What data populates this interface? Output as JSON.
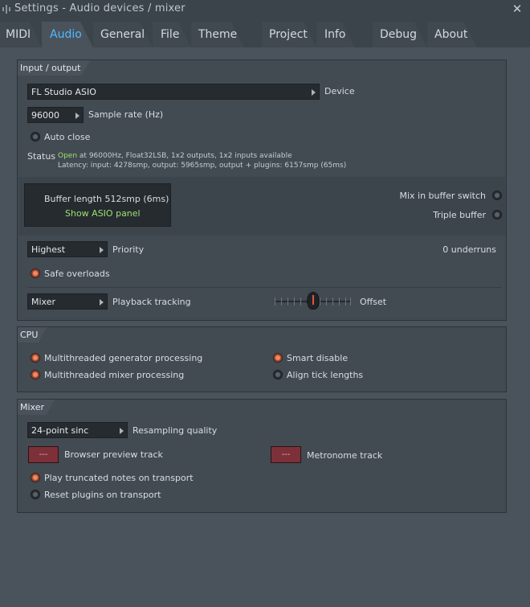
{
  "window": {
    "title": "Settings - Audio devices / mixer",
    "close_icon": "close-icon"
  },
  "tabs": [
    {
      "label": "MIDI"
    },
    {
      "label": "Audio"
    },
    {
      "label": "General"
    },
    {
      "label": "File"
    },
    {
      "label": "Theme"
    },
    {
      "label": "Project"
    },
    {
      "label": "Info"
    },
    {
      "label": "Debug"
    },
    {
      "label": "About"
    }
  ],
  "active_tab": "Audio",
  "io": {
    "header": "Input / output",
    "device_value": "FL Studio ASIO",
    "device_label": "Device",
    "sample_rate_value": "96000",
    "sample_rate_label": "Sample rate (Hz)",
    "auto_close_label": "Auto close",
    "status_label": "Status",
    "status_open": "Open",
    "status_line1_rest": " at 96000Hz, Float32LSB, 1x2 outputs, 1x2 inputs available",
    "status_line2": "Latency: input: 4278smp, output: 5965smp, output + plugins: 6157smp (65ms)",
    "buffer_length": "Buffer length 512smp (6ms)",
    "show_asio_panel": "Show ASIO panel",
    "mix_in_buffer_switch": "Mix in buffer switch",
    "triple_buffer": "Triple buffer",
    "priority_value": "Highest",
    "priority_label": "Priority",
    "underruns": "0 underruns",
    "safe_overloads": "Safe overloads",
    "playback_value": "Mixer",
    "playback_label": "Playback tracking",
    "offset_label": "Offset",
    "offset_level": 0.5
  },
  "cpu": {
    "header": "CPU",
    "multithreaded_generator": "Multithreaded generator processing",
    "multithreaded_mixer": "Multithreaded mixer processing",
    "smart_disable": "Smart disable",
    "align_tick_lengths": "Align tick lengths"
  },
  "mixer": {
    "header": "Mixer",
    "resampling_value": "24-point sinc",
    "resampling_label": "Resampling quality",
    "browser_preview_btn": "---",
    "browser_preview_label": "Browser preview track",
    "metronome_btn": "---",
    "metronome_label": "Metronome track",
    "play_truncated": "Play truncated notes on transport",
    "reset_plugins": "Reset plugins on transport"
  },
  "colors": {
    "accent_tab": "#53b8ff",
    "status_green": "#9fe071",
    "radio_on": "#f18a5f",
    "led_red": "#7d3038"
  }
}
